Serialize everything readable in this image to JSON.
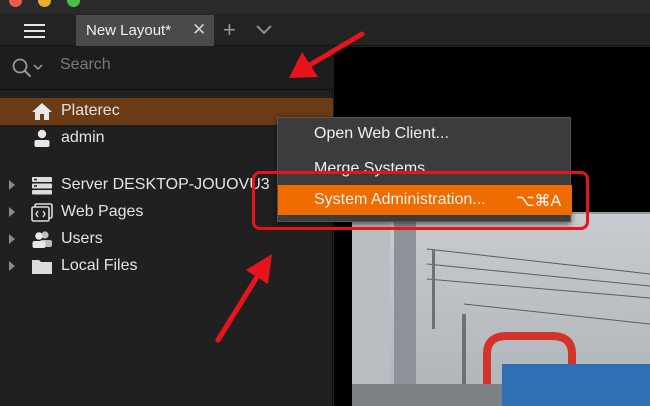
{
  "tabs": [
    {
      "label": "New Layout*",
      "close_icon": "close-icon"
    }
  ],
  "search": {
    "placeholder": "Search"
  },
  "tree": {
    "items": [
      {
        "label": "Platerec",
        "icon": "home-icon",
        "selected": true
      },
      {
        "label": "admin",
        "icon": "user-icon"
      },
      {
        "label": "Server DESKTOP-JOUOVU3",
        "icon": "server-icon"
      },
      {
        "label": "Web Pages",
        "icon": "web-pages-icon"
      },
      {
        "label": "Users",
        "icon": "users-icon"
      },
      {
        "label": "Local Files",
        "icon": "folder-icon"
      }
    ]
  },
  "context_menu": {
    "items": [
      {
        "label": "Open Web Client..."
      },
      {
        "label": "Merge Systems..."
      },
      {
        "label": "System Administration...",
        "shortcut": "⌥⌘A",
        "highlighted": true
      }
    ]
  },
  "colors": {
    "accent": "#ef6c00",
    "selection": "#6a3b14",
    "annotation": "#e8141c"
  }
}
